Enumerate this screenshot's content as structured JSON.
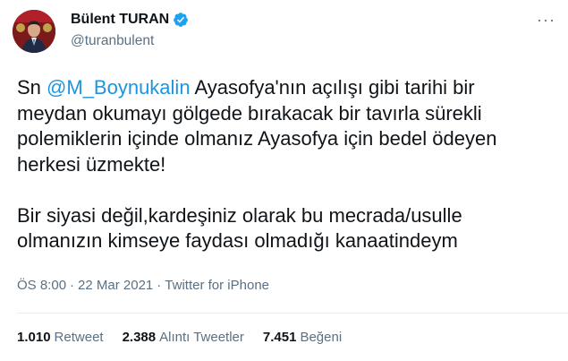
{
  "author": {
    "display_name": "Bülent TURAN",
    "handle": "@turanbulent",
    "avatar_icon": "profile-photo",
    "verified_icon": "verified-badge-icon",
    "verified_color": "#1da1f2"
  },
  "tweet": {
    "lines": [
      {
        "prefix": "Sn ",
        "mention": "@M_Boynukalin",
        "text": " Ayasofya'nın açılışı gibi tarihi bir"
      },
      {
        "text": "meydan okumayı gölgede bırakacak bir tavırla sürekli"
      },
      {
        "text": "polemiklerin içinde olmanız Ayasofya için bedel ödeyen"
      },
      {
        "text": "herkesi üzmekte!"
      },
      {
        "text": "Bir siyasi değil,kardeşiniz olarak bu mecrada/usulle"
      },
      {
        "text": "olmanızın kimseye faydası olmadığı kanaatindeym"
      }
    ]
  },
  "meta": {
    "time": "ÖS 8:00",
    "sep1": "·",
    "date": "22 Mar 2021",
    "sep2": "·",
    "source": "Twitter for iPhone"
  },
  "stats": {
    "retweets": {
      "count": "1.010",
      "label": "Retweet"
    },
    "quotes": {
      "count": "2.388",
      "label": "Alıntı Tweetler"
    },
    "likes": {
      "count": "7.451",
      "label": "Beğeni"
    }
  },
  "more_menu": "···",
  "colors": {
    "mention": "#1b95e0",
    "secondary_text": "#5b7083",
    "divider": "#e6ecf0"
  }
}
